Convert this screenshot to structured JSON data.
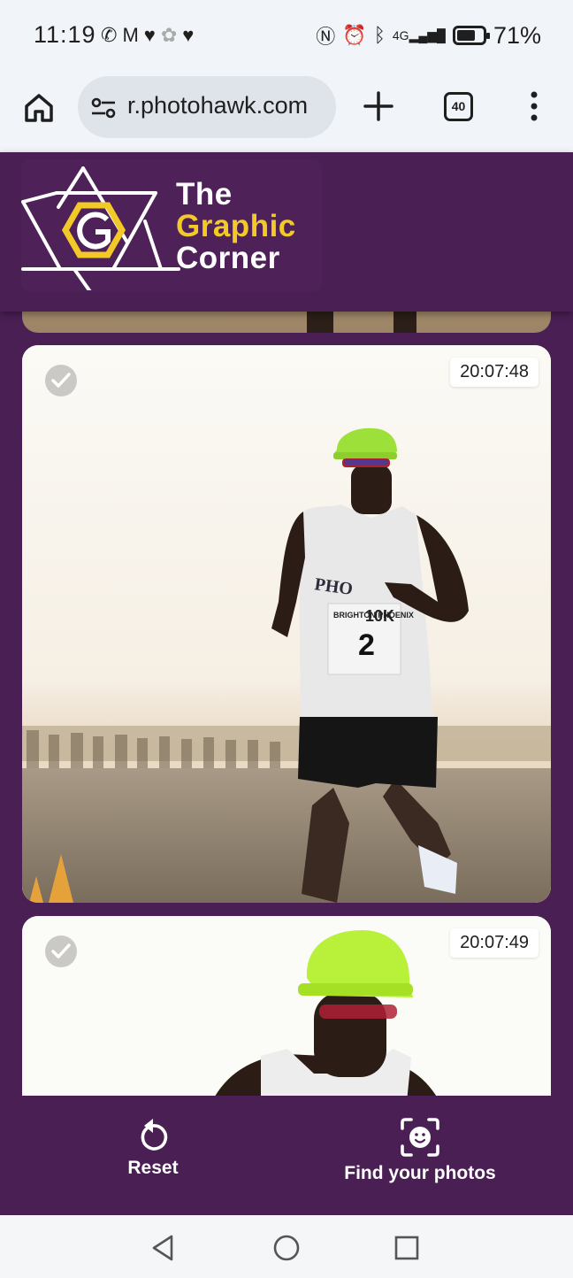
{
  "status_bar": {
    "time": "11:19",
    "left_icons": [
      "whatsapp-icon",
      "gmail-icon",
      "heart-icon",
      "app-icon",
      "heart-icon"
    ],
    "network": "4G",
    "battery_percent": "71%",
    "battery_level": 0.71
  },
  "browser": {
    "url": "r.photohawk.com",
    "tab_count": "40"
  },
  "site": {
    "logo_line1": "The",
    "logo_line2": "Graphic",
    "logo_line3": "Corner",
    "brand_purple": "#4a1f54",
    "brand_yellow": "#f3c928"
  },
  "photos": [
    {
      "timestamp": "",
      "selected": false
    },
    {
      "timestamp": "20:07:48",
      "selected": false,
      "bib_title": "BRIGHTON PHOENIX",
      "bib_race": "10K",
      "bib_number": "2",
      "vest_text": "PHO"
    },
    {
      "timestamp": "20:07:49",
      "selected": false
    }
  ],
  "actions": {
    "reset_label": "Reset",
    "find_label": "Find your photos"
  }
}
